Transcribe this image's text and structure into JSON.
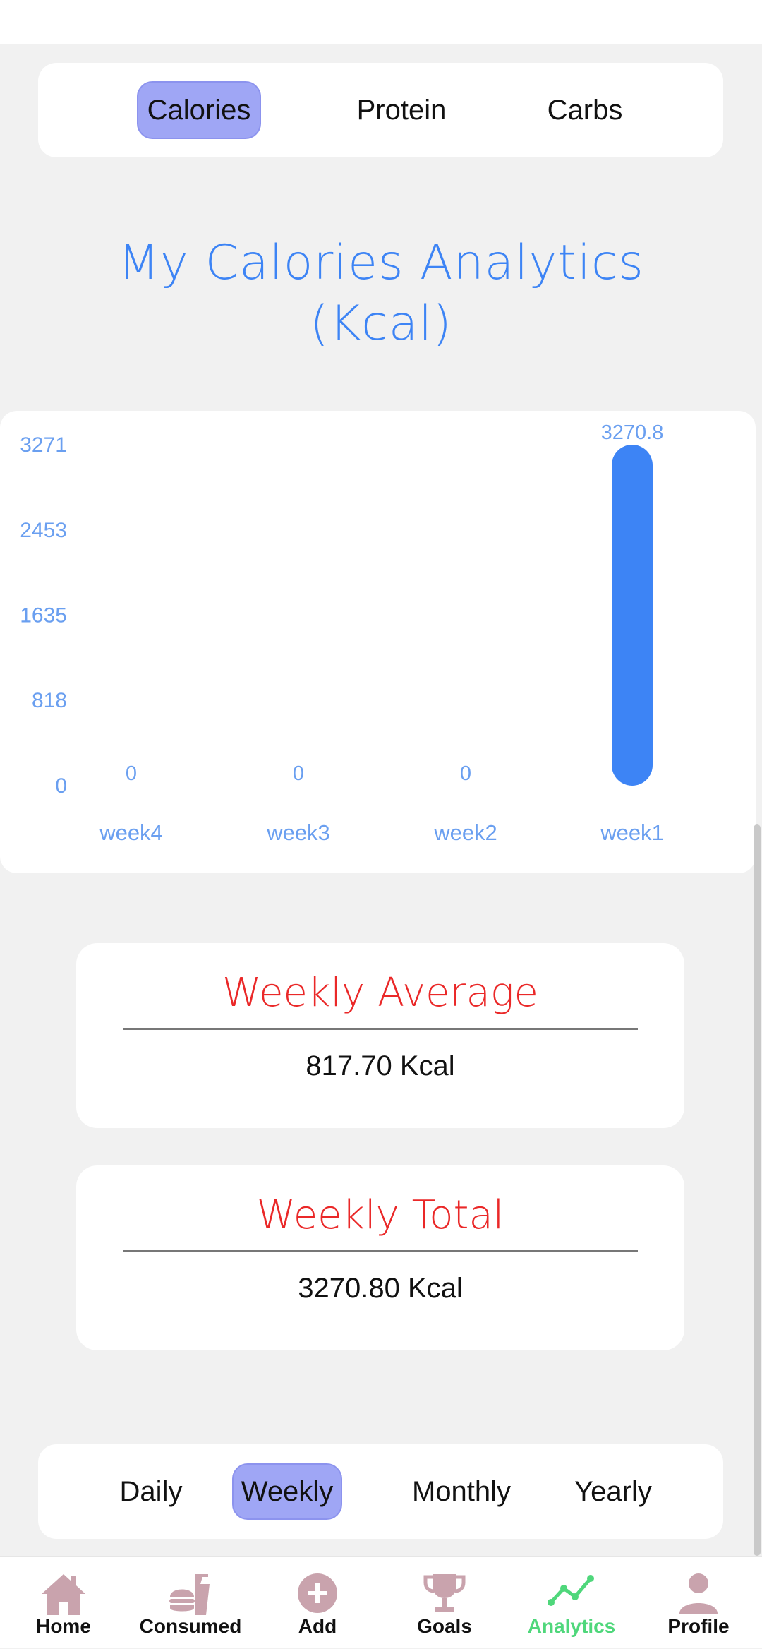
{
  "metric_tabs": [
    {
      "label": "Calories",
      "active": true
    },
    {
      "label": "Protein",
      "active": false
    },
    {
      "label": "Carbs",
      "active": false
    }
  ],
  "title": {
    "line1": "My Calories Analytics",
    "line2": "(Kcal)"
  },
  "chart_data": {
    "type": "bar",
    "categories": [
      "week4",
      "week3",
      "week2",
      "week1"
    ],
    "values": [
      0,
      0,
      0,
      3270.8
    ],
    "value_labels": [
      "0",
      "0",
      "0",
      "3270.8"
    ],
    "y_ticks": [
      "3271",
      "2453",
      "1635",
      "818",
      "0"
    ],
    "ylim": [
      0,
      3271
    ],
    "title": "",
    "xlabel": "",
    "ylabel": "",
    "grid": false,
    "bar_color": "#3d84f5",
    "label_color": "#6a9ff0"
  },
  "stats": {
    "average": {
      "heading": "Weekly Average",
      "value": "817.70 Kcal"
    },
    "total": {
      "heading": "Weekly Total",
      "value": "3270.80 Kcal"
    }
  },
  "period_tabs": [
    {
      "label": "Daily",
      "active": false
    },
    {
      "label": "Weekly",
      "active": true
    },
    {
      "label": "Monthly",
      "active": false
    },
    {
      "label": "Yearly",
      "active": false
    }
  ],
  "bottom_nav": [
    {
      "label": "Home",
      "icon": "home-icon",
      "active": false
    },
    {
      "label": "Consumed",
      "icon": "burger-drink-icon",
      "active": false
    },
    {
      "label": "Add",
      "icon": "plus-circle-icon",
      "active": false
    },
    {
      "label": "Goals",
      "icon": "trophy-icon",
      "active": false
    },
    {
      "label": "Analytics",
      "icon": "trend-line-icon",
      "active": true
    },
    {
      "label": "Profile",
      "icon": "person-icon",
      "active": false
    }
  ],
  "colors": {
    "accent": "#3d84f5",
    "active_pill": "#9fa6f5",
    "stat_heading": "#ea2828",
    "nav_icon": "#c9a3ad",
    "nav_active": "#4fd77b"
  }
}
